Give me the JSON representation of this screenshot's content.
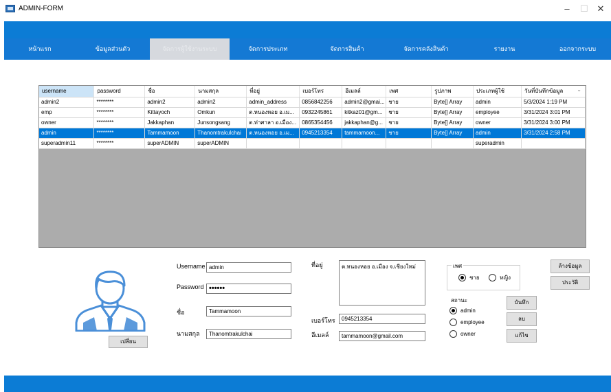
{
  "window": {
    "title": "ADMIN-FORM",
    "minimize": "–",
    "maximize": "☐",
    "close": "✕"
  },
  "nav": {
    "items": [
      {
        "label": "หน้าแรก"
      },
      {
        "label": "ข้อมูลส่วนตัว"
      },
      {
        "label": "จัดการผู้ใช้งานระบบ"
      },
      {
        "label": "จัดการประเภท"
      },
      {
        "label": "จัดการสินค้า"
      },
      {
        "label": "จัดการคลังสินค้า"
      },
      {
        "label": "รายงาน"
      },
      {
        "label": "ออกจากระบบ"
      }
    ]
  },
  "grid": {
    "columns": [
      "username",
      "password",
      "ชื่อ",
      "นามสกุล",
      "ที่อยู่",
      "เบอร์โทร",
      "อีเมลล์",
      "เพศ",
      "รูปภาพ",
      "ประเภทผู้ใช้",
      "วันที่บันทึกข้อมูล"
    ],
    "rows": [
      {
        "cells": [
          "admin2",
          "********",
          "admin2",
          "admin2",
          "admin_address",
          "0856842256",
          "admin2@gmai...",
          "ชาย",
          "Byte[] Array",
          "admin",
          "5/3/2024 1:19 PM"
        ]
      },
      {
        "cells": [
          "emp",
          "********",
          "Kittayoch",
          "Omkun",
          "ต.หนองหอย อ.เม...",
          "0932245861",
          "kitkaz01@gm...",
          "ชาย",
          "Byte[] Array",
          "employee",
          "3/31/2024 3:01 PM"
        ]
      },
      {
        "cells": [
          "owner",
          "********",
          "Jakkaphan",
          "Junsongsang",
          "ต.ท่าศาลา อ.เมือง...",
          "0865354456",
          "jakkaphan@g...",
          "ชาย",
          "Byte[] Array",
          "owner",
          "3/31/2024 3:00 PM"
        ]
      },
      {
        "cells": [
          "admin",
          "********",
          "Tammamoon",
          "Thanomtrakulchai",
          "ต.หนองหอย อ.เม...",
          "0945213354",
          "tammamoon...",
          "ชาย",
          "Byte[] Array",
          "admin",
          "3/31/2024 2:58 PM"
        ]
      },
      {
        "cells": [
          "superadmin11",
          "********",
          "superADMIN",
          "superADMIN",
          "",
          "",
          "",
          "",
          "",
          "superadmin",
          ""
        ]
      }
    ],
    "selected_row": 3
  },
  "form": {
    "change_button": "เปลี่ยน",
    "username_label": "Username",
    "username_value": "admin",
    "password_label": "Password",
    "password_value": "••••••",
    "firstname_label": "ชื่อ",
    "firstname_value": "Tammamoon",
    "lastname_label": "นามสกุล",
    "lastname_value": "Thanomtrakulchai",
    "address_label": "ที่อยู่",
    "address_value": "ต.หนองหอย อ.เมือง จ.เชียงใหม่",
    "phone_label": "เบอร์โทร",
    "phone_value": "0945213354",
    "email_label": "อีเมลล์",
    "email_value": "tammamoon@gmail.com",
    "gender_title": "เพศ",
    "gender_male": "ชาย",
    "gender_female": "หญิง",
    "status_title": "สถานะ",
    "status_admin": "admin",
    "status_employee": "employee",
    "status_owner": "owner",
    "clear_button": "ล้างข้อมูล",
    "history_button": "ประวัติ",
    "save_button": "บันทึก",
    "delete_button": "ลบ",
    "edit_button": "แก้ไข"
  },
  "colors": {
    "bar_blue": "#0c7cd5",
    "selection_blue": "#0078d7",
    "avatar_blue": "#4a8fd8"
  }
}
